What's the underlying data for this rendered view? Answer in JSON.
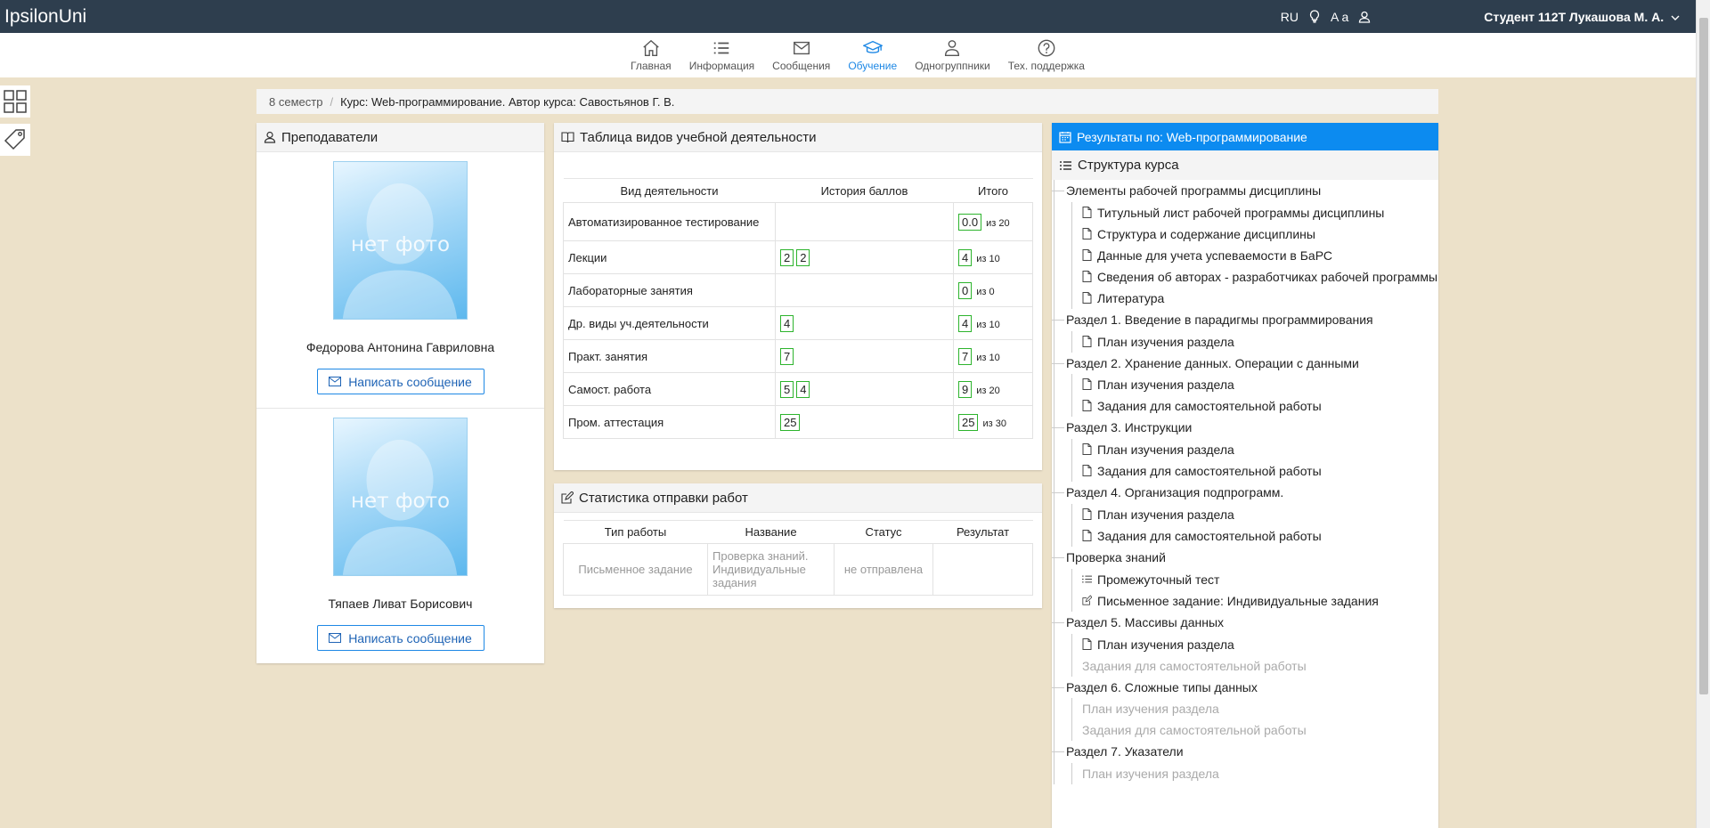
{
  "topbar": {
    "brand": "IpsilonUni",
    "lang": "RU",
    "font_size": "A a",
    "user": "Студент 112Т Лукашова М. А."
  },
  "nav": [
    {
      "label": "Главная",
      "icon": "home-icon"
    },
    {
      "label": "Информация",
      "icon": "list-icon"
    },
    {
      "label": "Сообщения",
      "icon": "mail-icon"
    },
    {
      "label": "Обучение",
      "icon": "graduation-cap-icon",
      "active": true
    },
    {
      "label": "Одногруппники",
      "icon": "users-icon"
    },
    {
      "label": "Тех. поддержка",
      "icon": "help-icon"
    }
  ],
  "breadcrumb": {
    "semester": "8 семестр",
    "course": "Курс: Web-программирование. Автор курса: Савостьянов Г. В."
  },
  "teachers": {
    "title": "Преподаватели",
    "no_photo": "нет фото",
    "button_label": "Написать сообщение",
    "items": [
      {
        "name": "Федорова Антонина Гавриловна"
      },
      {
        "name": "Тяпаев Ливат Борисович"
      }
    ]
  },
  "activity": {
    "title": "Таблица видов учебной деятельности",
    "columns": [
      "Вид деятельности",
      "История баллов",
      "Итого"
    ],
    "rows": [
      {
        "name": "Автоматизированное тестирование",
        "history": [],
        "total": "0.0",
        "max": "из 20"
      },
      {
        "name": "Лекции",
        "history": [
          "2",
          "2"
        ],
        "total": "4",
        "max": "из 10"
      },
      {
        "name": "Лабораторные занятия",
        "history": [],
        "total": "0",
        "max": "из 0"
      },
      {
        "name": "Др. виды уч.деятельности",
        "history": [
          "4"
        ],
        "total": "4",
        "max": "из 10"
      },
      {
        "name": "Практ. занятия",
        "history": [
          "7"
        ],
        "total": "7",
        "max": "из 10"
      },
      {
        "name": "Самост. работа",
        "history": [
          "5",
          "4"
        ],
        "total": "9",
        "max": "из 20"
      },
      {
        "name": "Пром. аттестация",
        "history": [
          "25"
        ],
        "total": "25",
        "max": "из 30"
      }
    ]
  },
  "stats": {
    "title": "Статистика отправки работ",
    "columns": [
      "Тип работы",
      "Название",
      "Статус",
      "Результат"
    ],
    "rows": [
      {
        "type": "Письменное задание",
        "name": "Проверка знаний. Индивидуальные задания",
        "status": "не отправлена",
        "result": ""
      }
    ]
  },
  "results": {
    "title": "Результаты по: Web-программирование",
    "structure_title": "Структура курса",
    "sections": [
      {
        "title": "Элементы рабочей программы дисциплины",
        "items": [
          {
            "label": "Титульный лист рабочей программы дисциплины",
            "icon": "doc"
          },
          {
            "label": "Структура и содержание дисциплины",
            "icon": "doc"
          },
          {
            "label": "Данные для учета успеваемости в БаРС",
            "icon": "doc"
          },
          {
            "label": "Сведения об авторах - разработчиках рабочей программы",
            "icon": "doc"
          },
          {
            "label": "Литература",
            "icon": "doc"
          }
        ]
      },
      {
        "title": "Раздел 1. Введение в парадигмы программирования",
        "items": [
          {
            "label": "План изучения раздела",
            "icon": "doc"
          }
        ]
      },
      {
        "title": "Раздел 2. Хранение данных. Операции с данными",
        "items": [
          {
            "label": "План изучения раздела",
            "icon": "doc"
          },
          {
            "label": "Задания для самостоятельной работы",
            "icon": "doc"
          }
        ]
      },
      {
        "title": "Раздел 3. Инструкции",
        "items": [
          {
            "label": "План изучения раздела",
            "icon": "doc"
          },
          {
            "label": "Задания для самостоятельной работы",
            "icon": "doc"
          }
        ]
      },
      {
        "title": "Раздел 4. Организация подпрограмм.",
        "items": [
          {
            "label": "План изучения раздела",
            "icon": "doc"
          },
          {
            "label": "Задания для самостоятельной работы",
            "icon": "doc"
          }
        ]
      },
      {
        "title": "Проверка знаний",
        "items": [
          {
            "label": "Промежуточный тест",
            "icon": "list"
          },
          {
            "label": "Письменное задание: Индивидуальные задания",
            "icon": "edit"
          }
        ]
      },
      {
        "title": "Раздел 5. Массивы данных",
        "items": [
          {
            "label": "План изучения раздела",
            "icon": "doc"
          },
          {
            "label": "Задания для самостоятельной работы",
            "icon": "none",
            "dim": true
          }
        ]
      },
      {
        "title": "Раздел 6. Сложные типы данных",
        "items": [
          {
            "label": "План изучения раздела",
            "icon": "none",
            "dim": true
          },
          {
            "label": "Задания для самостоятельной работы",
            "icon": "none",
            "dim": true
          }
        ]
      },
      {
        "title": "Раздел 7. Указатели",
        "items": [
          {
            "label": "План изучения раздела",
            "icon": "none",
            "dim": true
          }
        ]
      }
    ]
  }
}
